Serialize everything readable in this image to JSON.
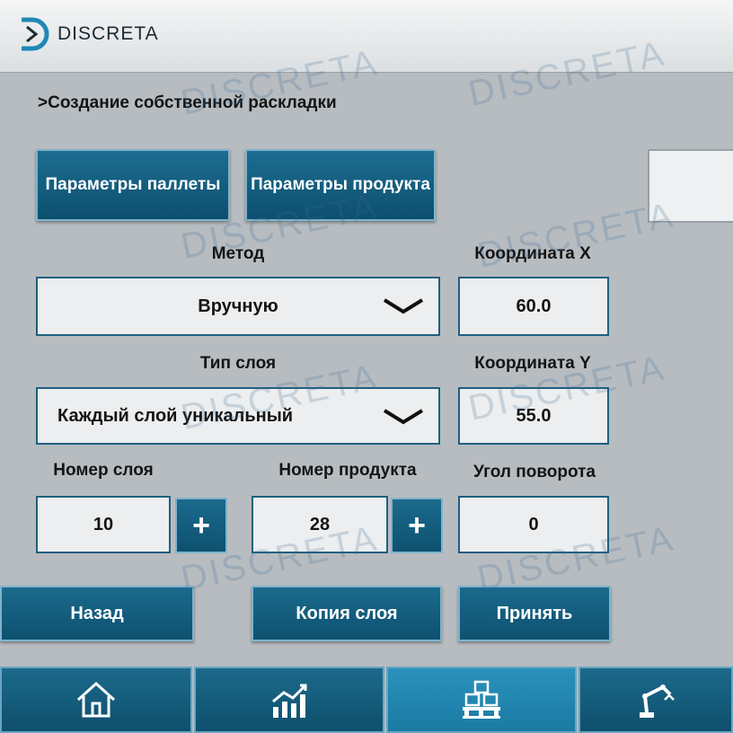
{
  "brand": {
    "logo_text": "DISCRETA"
  },
  "breadcrumb": ">Создание собственной раскладки",
  "buttons": {
    "pallet_params": "Параметры паллеты",
    "product_params": "Параметры продукта",
    "back": "Назад",
    "copy_layer": "Копия слоя",
    "accept": "Принять",
    "plus": "+"
  },
  "fields": {
    "method": {
      "label": "Метод",
      "value": "Вручную"
    },
    "layer_type": {
      "label": "Тип слоя",
      "value": "Каждый слой уникальный"
    },
    "coord_x": {
      "label": "Координата X",
      "value": "60.0"
    },
    "coord_y": {
      "label": "Координата Y",
      "value": "55.0"
    },
    "layer_number": {
      "label": "Номер слоя",
      "value": "10"
    },
    "product_number": {
      "label": "Номер продукта",
      "value": "28"
    },
    "rotation_angle": {
      "label": "Угол поворота",
      "value": "0"
    }
  },
  "nav": {
    "items": [
      {
        "icon": "home-icon"
      },
      {
        "icon": "chart-icon"
      },
      {
        "icon": "pallet-icon",
        "active": true
      },
      {
        "icon": "robot-arm-icon"
      }
    ]
  },
  "colors": {
    "accent": "#0e5170",
    "active": "#1a7aa3",
    "background": "#b7bcc0"
  }
}
